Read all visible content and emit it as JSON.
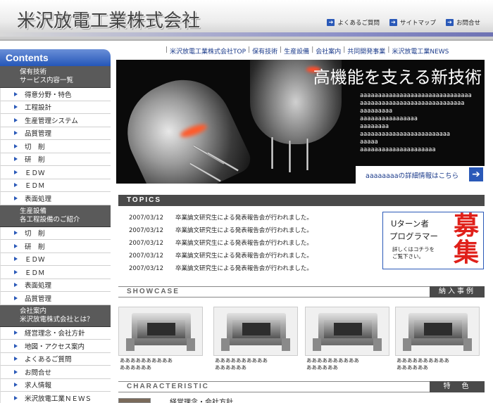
{
  "header": {
    "title": "米沢放電工業株式会社",
    "links": [
      {
        "label": "よくあるご質問",
        "icon": "arrow-right-icon"
      },
      {
        "label": "サイトマップ",
        "icon": "arrow-right-icon"
      },
      {
        "label": "お問合せ",
        "icon": "arrow-right-icon"
      }
    ]
  },
  "sidebar": {
    "contents_label": "Contents",
    "sections": [
      {
        "title_line1": "保有技術",
        "title_line2": "サービス内容一覧",
        "items": [
          "得意分野・特色",
          "工程設計",
          "生産管理システム",
          "品質管理",
          "切　削",
          "研　削",
          "ＥＤＷ",
          "ＥＤＭ",
          "表面処理"
        ]
      },
      {
        "title_line1": "生産設備",
        "title_line2": "各工程設備のご紹介",
        "items": [
          "切　削",
          "研　削",
          "ＥＤＷ",
          "ＥＤＭ",
          "表面処理",
          "品質管理"
        ]
      },
      {
        "title_line1": "会社案内",
        "title_line2": "米沢放電株式会社とは？",
        "items": [
          "経営理念・会社方針",
          "地図・アクセス案内",
          "よくあるご質問",
          "お問合せ",
          "求人情報",
          "米沢放電工業ＮＥＷＳ"
        ]
      }
    ]
  },
  "nav": {
    "links": [
      "米沢放電工業株式会社TOP",
      "保有技術",
      "生産設備",
      "会社案内",
      "共同開発事業",
      "米沢放電工業NEWS"
    ]
  },
  "hero": {
    "heading": "高機能を支える新技術",
    "lines": [
      "aaaaaaaaaaaaaaaaaaaaaaaaaaaaaaa",
      "aaaaaaaaaaaaaaaaaaaaaaaaaaaaa",
      "aaaaaaaaa",
      "aaaaaaaaaaaaaaaa",
      "aaaaaaaa",
      "aaaaaaaaaaaaaaaaaaaaaaaaa",
      "aaaaa",
      "aaaaaaaaaaaaaaaaaaaaa"
    ],
    "detail_link": "aaaaaaaaの詳細情報はこちら"
  },
  "topics": {
    "heading": "TOPICS",
    "items": [
      {
        "date": "2007/03/12",
        "text": "卒業論文研究生による発表報告会が行われました。"
      },
      {
        "date": "2007/03/12",
        "text": "卒業論文研究生による発表報告会が行われました。"
      },
      {
        "date": "2007/03/12",
        "text": "卒業論文研究生による発表報告会が行われました。"
      },
      {
        "date": "2007/03/12",
        "text": "卒業論文研究生による発表報告会が行われました。"
      },
      {
        "date": "2007/03/12",
        "text": "卒業論文研究生による発表報告会が行われました。"
      }
    ]
  },
  "recruit": {
    "line1": "Uターン者",
    "line2": "プログラマー",
    "line3": "詳しくはコチラを",
    "line4": "ご覧下さい。",
    "big1": "募",
    "big2": "集"
  },
  "showcase": {
    "heading": "SHOWCASE",
    "tag": "納入事例",
    "cards": [
      {
        "cap1": "ああああああああああ",
        "cap2": "ああああああ"
      },
      {
        "cap1": "ああああああああああ",
        "cap2": "ああああああ"
      },
      {
        "cap1": "ああああああああああ",
        "cap2": "ああああああ"
      },
      {
        "cap1": "ああああああああああ",
        "cap2": "ああああああ"
      }
    ]
  },
  "characteristic": {
    "heading": "CHARACTERISTIC",
    "tag": "特　色",
    "text": "経営理念・会社方針"
  }
}
